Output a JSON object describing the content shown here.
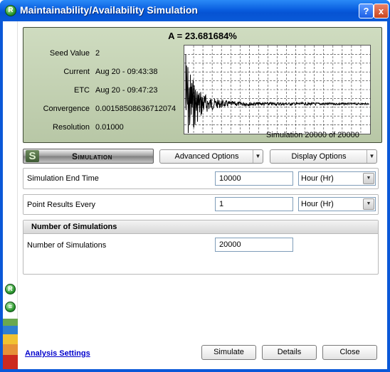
{
  "window": {
    "title": "Maintainability/Availability Simulation",
    "help_label": "?",
    "close_label": "x"
  },
  "progress": {
    "availability": "A = 23.681684%",
    "seed_label": "Seed Value",
    "seed_value": "2",
    "current_label": "Current",
    "current_value": "Aug 20 - 09:43:38",
    "etc_label": "ETC",
    "etc_value": "Aug 20 - 09:47:23",
    "convergence_label": "Convergence",
    "convergence_value": "0.00158508636712074",
    "resolution_label": "Resolution",
    "resolution_value": "0.01000",
    "status": "Simulation 20000 of 20000"
  },
  "toolbar": {
    "logo_letter": "S",
    "logo_text": "Simulation",
    "advanced_options": "Advanced Options",
    "display_options": "Display Options"
  },
  "fields": {
    "end_time_label": "Simulation End Time",
    "end_time_value": "10000",
    "end_time_unit": "Hour (Hr)",
    "point_results_label": "Point Results Every",
    "point_results_value": "1",
    "point_results_unit": "Hour (Hr)"
  },
  "simulations_group": {
    "header": "Number of Simulations",
    "label": "Number of Simulations",
    "value": "20000"
  },
  "footer": {
    "analysis_settings": "Analysis Settings",
    "simulate": "Simulate",
    "details": "Details",
    "close": "Close"
  },
  "colors": {
    "titlebar": "#0a5fe0",
    "panel": "#c2d1b1",
    "link": "#0000cc"
  }
}
